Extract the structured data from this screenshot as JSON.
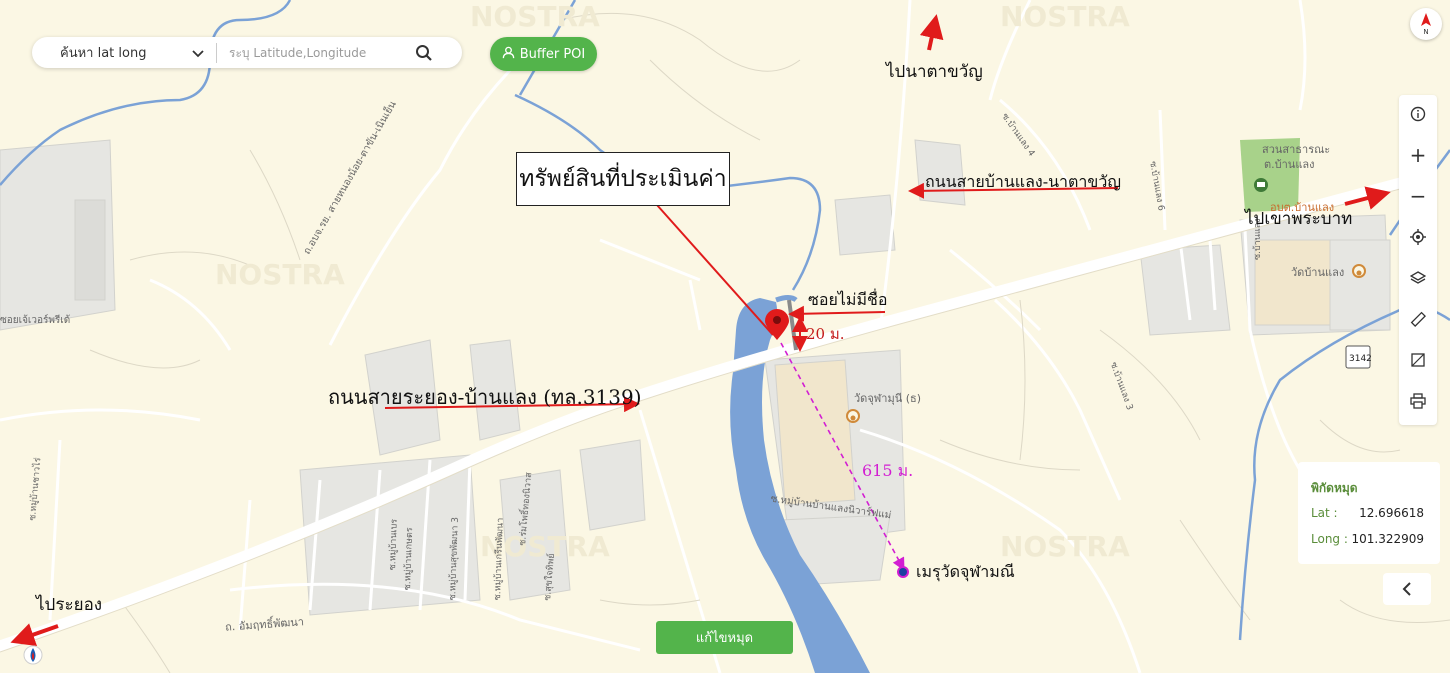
{
  "search": {
    "mode_label": "ค้นหา lat long",
    "placeholder": "ระบุ Latitude,Longitude"
  },
  "buffer_button": {
    "label": "Buffer POI",
    "icon": "user-icon"
  },
  "annotations": {
    "property_title": "ทรัพย์สินที่ประเมินค่า",
    "unnamed_soi": "ซอยไม่มีชื่อ",
    "soi_distance": "20 ม.",
    "main_road": "ถนนสายระยอง-บ้านแลง (ทล.3139)",
    "road_naka": "ถนนสายบ้านแลง-นาตาขวัญ",
    "to_naka": "ไปนาตาขวัญ",
    "to_khaophrabat": "ไปเขาพระบาท",
    "to_rayong": "ไประยอง",
    "temple_distance": "615 ม.",
    "temple_meru": "เมรุวัดจุฬามณี"
  },
  "map_labels": {
    "wat_chulamanee": "วัดจุฬามุนี (ธ)",
    "wat_ban_laeng": "วัดบ้านแลง",
    "park_line1": "สวนสาธารณะ",
    "park_line2": "ต.บ้านแลง",
    "tambon_office": "อบต.บ้านแลง",
    "road_3142": "3142",
    "road_sai_nongkhok": "ถ.อบจ.รย. สายหนองน้อย-ตาขัน-เนินเย็น",
    "road_ampathip": "ถ. อัมฤทธิ์พัฒนา",
    "village_label": "ซ.หมู่บ้านบ้านแลงนิวาร์ฟแม่",
    "soi_banlaeng4": "ซ.บ้านแลง 4",
    "soi_banlaeng6": "ซ.บ้านแลง 6",
    "soi_banlaeng3": "ซ.บ้านแลง 3",
    "soi_banlaeng": "ซ.บ้านแลง",
    "left_village": "ซอยเจ้เวอร์พรีเด้",
    "soi_village_a": "ซ.หมู่บ้านเบร",
    "soi_village_b": "ซ.หมู่บ้านเกษตร",
    "soi_village_c": "ซ.หมู่บ้านสุขพัฒนา 3",
    "soi_village_d": "ซ.หมู่บ้านเกรีนพัฒนา",
    "soi_village_e": "ซ.ร่มโพธิ์ทองนิวาส",
    "soi_village_f": "ซ.สุขใจทิพย์",
    "soi_village_g": "ซ.หมู่บ้านชาวไร่",
    "watermark": "NOSTRA"
  },
  "toolbar": {
    "items": [
      "info-icon",
      "zoom-in-icon",
      "zoom-out-icon",
      "locate-icon",
      "layers-icon",
      "ruler-icon",
      "area-measure-icon",
      "print-icon"
    ],
    "zoom_in": "+",
    "zoom_out": "−"
  },
  "coordinates": {
    "title": "พิกัดหมุด",
    "lat_label": "Lat :",
    "lat_value": "12.696618",
    "long_label": "Long :",
    "long_value": "101.322909"
  },
  "fix_pin_button": {
    "label": "แก้ไขหมุด"
  },
  "colors": {
    "land": "#fbf7e4",
    "river": "#7ba2d6",
    "road": "#ffffff",
    "brand_green": "#53b44b",
    "annotation_red": "#e01b1b",
    "distance_magenta": "#d21ed2"
  }
}
